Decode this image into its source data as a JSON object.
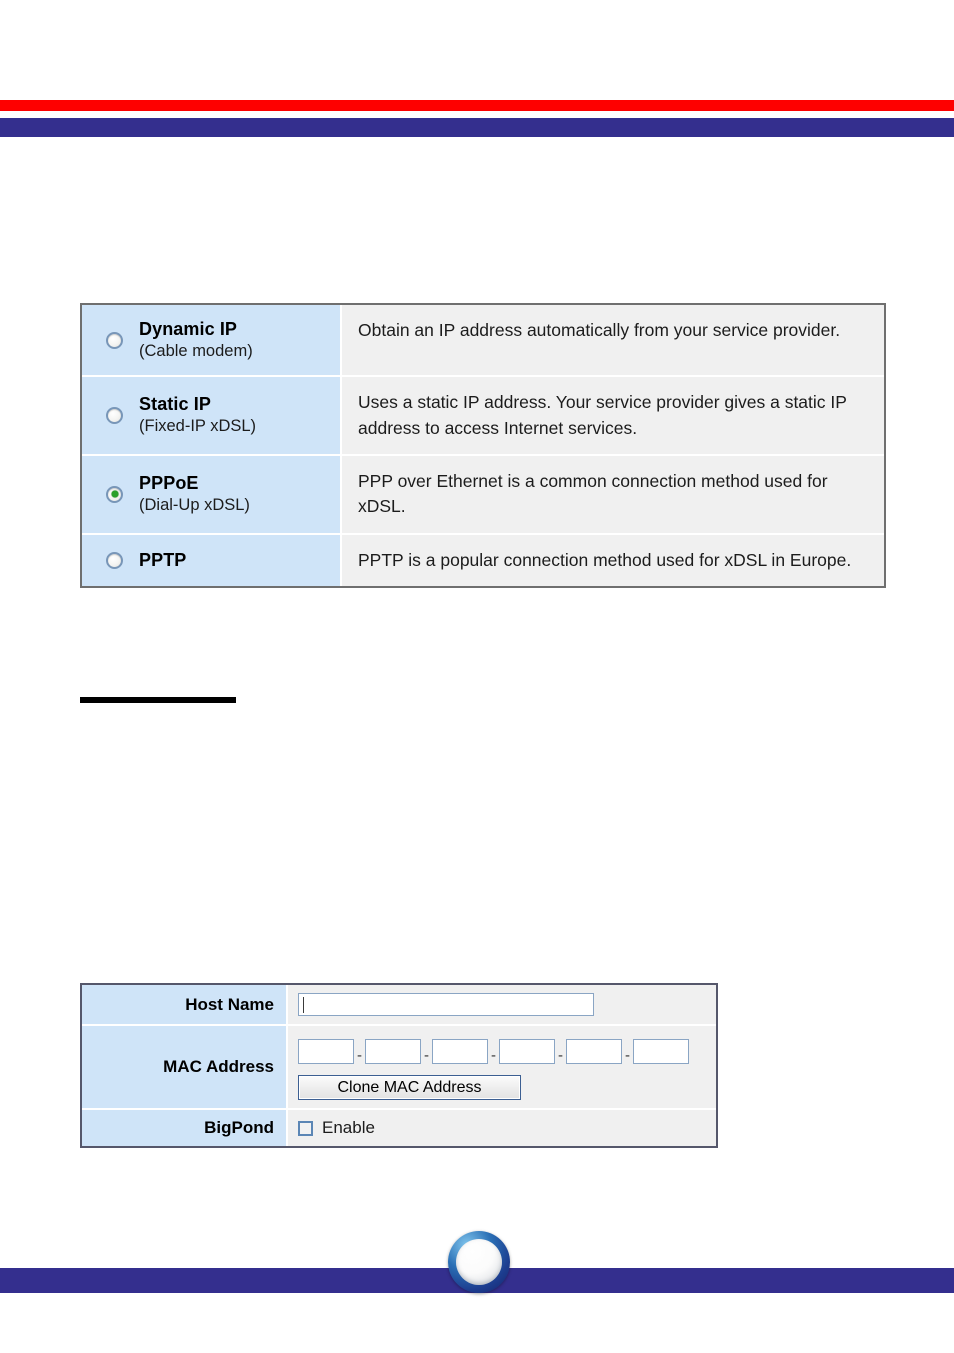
{
  "page": {
    "accent_red": "#fe0000",
    "accent_blue": "#342f8e",
    "panel_label_bg": "#cfe4f8",
    "panel_value_bg": "#f0f0f0"
  },
  "connection_types": {
    "rows": [
      {
        "title": "Dynamic IP",
        "subtitle": "(Cable modem)",
        "description": "Obtain an IP address automatically from your service provider.",
        "selected": false
      },
      {
        "title": "Static IP",
        "subtitle": "(Fixed-IP xDSL)",
        "description": "Uses a static IP address. Your service provider gives a static IP address to access Internet services.",
        "selected": false
      },
      {
        "title": "PPPoE",
        "subtitle": "(Dial-Up xDSL)",
        "description": "PPP over Ethernet is a common connection method used for xDSL.",
        "selected": true
      },
      {
        "title": "PPTP",
        "subtitle": "",
        "description": "PPTP is a popular connection method used for xDSL in Europe.",
        "selected": false
      }
    ]
  },
  "settings_form": {
    "host_name": {
      "label": "Host Name",
      "value": "",
      "placeholder": ""
    },
    "mac_address": {
      "label": "MAC Address",
      "separator": "-",
      "octets": [
        "",
        "",
        "",
        "",
        "",
        ""
      ],
      "clone_button": "Clone MAC Address"
    },
    "bigpond": {
      "label": "BigPond",
      "checkbox_label": "Enable",
      "checked": false
    }
  }
}
